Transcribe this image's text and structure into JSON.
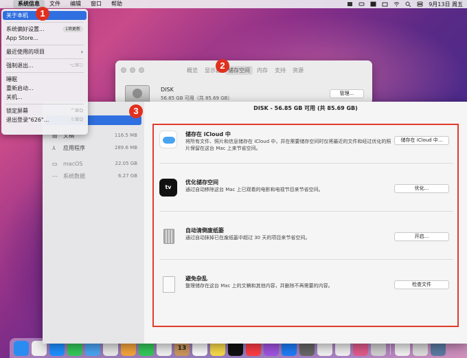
{
  "menubar": {
    "apple_glyph": "",
    "items": [
      "系统信息",
      "文件",
      "编辑",
      "窗口",
      "帮助"
    ],
    "datetime": "9月13日 周五"
  },
  "apple_menu": {
    "items": [
      {
        "label": "关于本机",
        "shortcut": "",
        "selected": true
      },
      {
        "label": "系统偏好设置...",
        "badge": "1项更新"
      },
      {
        "label": "App Store..."
      },
      {
        "label": "最近使用的项目",
        "arrow": "›"
      },
      {
        "label": "强制退出...",
        "shortcut": "⌥⌘⎋"
      },
      {
        "label": "睡眠"
      },
      {
        "label": "重新启动..."
      },
      {
        "label": "关机..."
      },
      {
        "label": "锁定屏幕",
        "shortcut": "^⌘Q"
      },
      {
        "label": "退出登录\"626\"...",
        "shortcut": "⇧⌘Q"
      }
    ]
  },
  "annotations": [
    "1",
    "2",
    "3"
  ],
  "about_window": {
    "tabs": [
      "概览",
      "显示器",
      "储存空间",
      "内存",
      "支持",
      "资源"
    ],
    "disk_name": "DISK",
    "disk_detail": "56.85 GB 可用（共 85.69 GB）",
    "manage_label": "管理..."
  },
  "storage_window": {
    "title": "DISK - 56.85 GB 可用 (共 85.69 GB)",
    "sidebar": [
      {
        "label": "文稿",
        "size": "116.5 MB",
        "icon": "document-icon"
      },
      {
        "label": "应用程序",
        "size": "289.6 MB",
        "icon": "apps-icon"
      },
      {
        "label": "macOS",
        "size": "22.05 GB",
        "icon": "monitor-icon"
      },
      {
        "label": "系统数据",
        "size": "6.27 GB",
        "icon": "dots-icon"
      }
    ],
    "recommendations": [
      {
        "title": "储存在 iCloud 中",
        "desc": "将所有文件、照片和信息储存在 iCloud 中，并在需要储存空间时仅将最近的文件和经过优化的照片保留在这台 Mac 上来节省空间。",
        "button": "储存在 iCloud 中..."
      },
      {
        "title": "优化储存空间",
        "desc": "通过自动移除这台 Mac 上已观看的电影和电视节目来节省空间。",
        "button": "优化..."
      },
      {
        "title": "自动清倒废纸篓",
        "desc": "通过自动抹掉已在废纸篓中超过 30 天的项目来节省空间。",
        "button": "开启..."
      },
      {
        "title": "避免杂乱",
        "desc": "整理储存在这台 Mac 上的文稿和其他内容，并删除不再需要的内容。",
        "button": "检查文件"
      }
    ],
    "tv_label": "tv"
  },
  "dock": {
    "calendar_day": "13",
    "app_colors": [
      "#2a8cf0",
      "#f0f0f0",
      "#1e90ff",
      "#34c759",
      "#4aa3f0",
      "#e8e8e8",
      "#f2a33a",
      "#34c759",
      "#f0f0f0",
      "#c9955a",
      "#fafafa",
      "#f5d84a",
      "#111111",
      "#fc3c44",
      "#a052e0",
      "#1e7cf5",
      "#666666",
      "#f0f0f0",
      "#f0f0f0",
      "#e05a8a",
      "#cfcfcf",
      "#f0f0f0",
      "#dcdcdc",
      "#5a7aa0"
    ]
  }
}
